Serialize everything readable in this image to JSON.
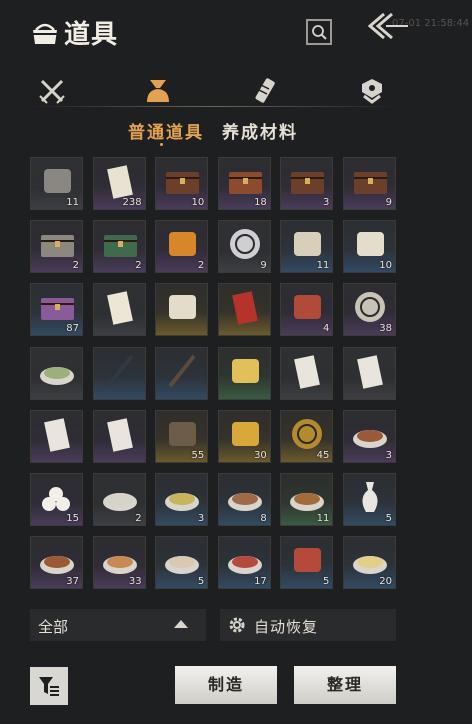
{
  "header": {
    "title": "道具",
    "timestamp": "07-01 21:58:44",
    "bag_icon": "bag-icon",
    "search_icon": "search-icon",
    "back_icon": "back-chevron-icon"
  },
  "category_tabs": [
    {
      "icon": "crossed-swords-icon",
      "active": false
    },
    {
      "icon": "item-bag-icon",
      "active": true
    },
    {
      "icon": "scroll-icon",
      "active": false
    },
    {
      "icon": "badge-icon",
      "active": false
    }
  ],
  "subtabs": {
    "active": "普通道具",
    "inactive": "养成材料"
  },
  "items": [
    {
      "icon": "stone-icon",
      "count": "11",
      "rarity": "grey"
    },
    {
      "icon": "ticket-icon",
      "count": "238",
      "rarity": "purple"
    },
    {
      "icon": "chest-icon",
      "count": "10",
      "rarity": "purple"
    },
    {
      "icon": "ornate-chest-icon",
      "count": "18",
      "rarity": "purple"
    },
    {
      "icon": "chest-icon",
      "count": "3",
      "rarity": "purple"
    },
    {
      "icon": "chest-icon",
      "count": "9",
      "rarity": "purple"
    },
    {
      "icon": "grey-box-icon",
      "count": "2",
      "rarity": "purple"
    },
    {
      "icon": "green-box-icon",
      "count": "2",
      "rarity": "purple"
    },
    {
      "icon": "orb-stand-icon",
      "count": "2",
      "rarity": "purple"
    },
    {
      "icon": "mountain-emblem-icon",
      "count": "9",
      "rarity": "grey"
    },
    {
      "icon": "painting-scroll-icon",
      "count": "11",
      "rarity": "blue"
    },
    {
      "icon": "jar-icon",
      "count": "10",
      "rarity": "blue"
    },
    {
      "icon": "gift-box-icon",
      "count": "87",
      "rarity": "blue"
    },
    {
      "icon": "name-card-icon",
      "count": "",
      "rarity": "grey"
    },
    {
      "icon": "book-icon",
      "count": "",
      "rarity": "gold"
    },
    {
      "icon": "red-card-icon",
      "count": "",
      "rarity": "gold"
    },
    {
      "icon": "pendant-icon",
      "count": "4",
      "rarity": "purple"
    },
    {
      "icon": "bird-medallion-icon",
      "count": "38",
      "rarity": "purple"
    },
    {
      "icon": "dumplings-icon",
      "count": "",
      "rarity": "grey"
    },
    {
      "icon": "flute-icon",
      "count": "",
      "rarity": "blue"
    },
    {
      "icon": "staff-icon",
      "count": "",
      "rarity": "blue"
    },
    {
      "icon": "gold-nuggets-icon",
      "count": "",
      "rarity": "green"
    },
    {
      "icon": "envelope-icon",
      "count": "",
      "rarity": "grey"
    },
    {
      "icon": "envelope-icon",
      "count": "",
      "rarity": "grey"
    },
    {
      "icon": "letter-icon",
      "count": "",
      "rarity": "purple"
    },
    {
      "icon": "letter-icon",
      "count": "",
      "rarity": "purple"
    },
    {
      "icon": "helmet-icon",
      "count": "55",
      "rarity": "gold"
    },
    {
      "icon": "gold-ingot-icon",
      "count": "30",
      "rarity": "gold"
    },
    {
      "icon": "coin-icon",
      "count": "45",
      "rarity": "gold"
    },
    {
      "icon": "stew-pot-icon",
      "count": "3",
      "rarity": "purple"
    },
    {
      "icon": "buns-icon",
      "count": "15",
      "rarity": "purple"
    },
    {
      "icon": "rice-bowl-icon",
      "count": "2",
      "rarity": "grey"
    },
    {
      "icon": "soup-bowl-icon",
      "count": "3",
      "rarity": "blue"
    },
    {
      "icon": "meat-plate-icon",
      "count": "8",
      "rarity": "blue"
    },
    {
      "icon": "stew-bowl-icon",
      "count": "11",
      "rarity": "green"
    },
    {
      "icon": "vase-icon",
      "count": "5",
      "rarity": "blue"
    },
    {
      "icon": "braised-bowl-icon",
      "count": "37",
      "rarity": "purple"
    },
    {
      "icon": "dim-sum-icon",
      "count": "33",
      "rarity": "purple"
    },
    {
      "icon": "fish-plate-icon",
      "count": "5",
      "rarity": "blue"
    },
    {
      "icon": "sausage-plate-icon",
      "count": "17",
      "rarity": "blue"
    },
    {
      "icon": "sliced-meat-icon",
      "count": "5",
      "rarity": "blue"
    },
    {
      "icon": "noodle-bowl-icon",
      "count": "20",
      "rarity": "blue"
    }
  ],
  "footer": {
    "filter_label": "全部",
    "auto_recover_label": "自动恢复",
    "craft_label": "制造",
    "tidy_label": "整理",
    "filter_icon": "caret-up-icon",
    "auto_icon": "gear-icon",
    "sort_icon": "sort-filter-icon"
  },
  "colors": {
    "accent": "#e3a251",
    "background": "#1e1f21",
    "button": "#e6e4df"
  }
}
